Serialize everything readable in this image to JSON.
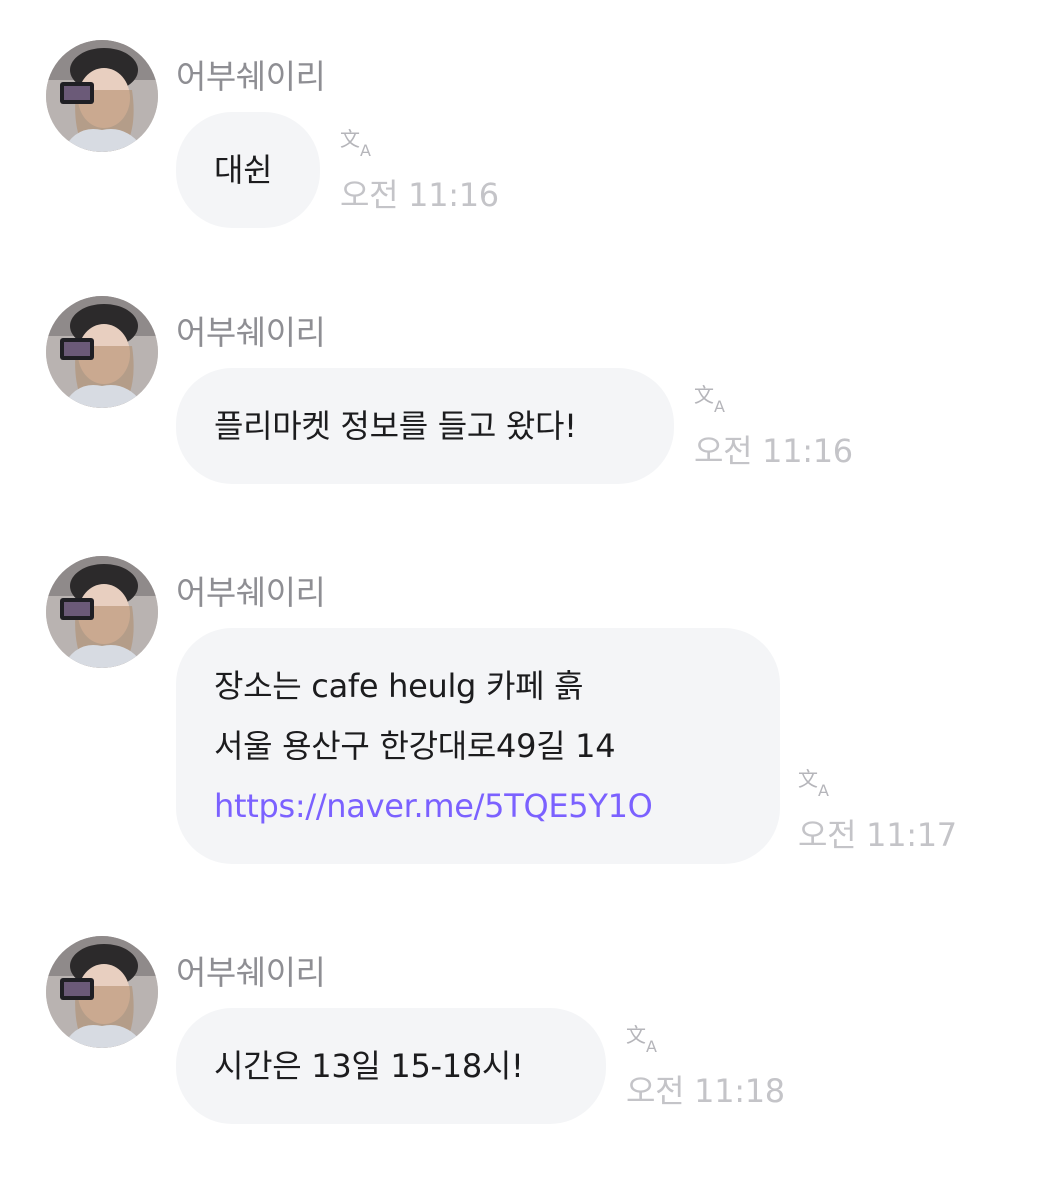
{
  "messages": [
    {
      "sender": "어부쉐이리",
      "lines": [
        "대쉰"
      ],
      "time": "오전 11:16",
      "translate_icon": "translate-icon"
    },
    {
      "sender": "어부쉐이리",
      "lines": [
        "플리마켓 정보를 들고 왔다!"
      ],
      "time": "오전 11:16",
      "translate_icon": "translate-icon"
    },
    {
      "sender": "어부쉐이리",
      "lines": [
        "장소는 cafe heulg 카페 흙",
        "서울 용산구 한강대로49길 14"
      ],
      "link": "https://naver.me/5TQE5Y1O",
      "time": "오전 11:17",
      "translate_icon": "translate-icon"
    },
    {
      "sender": "어부쉐이리",
      "lines": [
        "시간은 13일 15-18시!"
      ],
      "time": "오전 11:18",
      "translate_icon": "translate-icon"
    }
  ],
  "colors": {
    "bubble": "#f4f5f7",
    "sender_text": "#8e8e93",
    "time_text": "#c4c4c8",
    "link": "#7b61ff",
    "message_text": "#1c1c1e"
  }
}
